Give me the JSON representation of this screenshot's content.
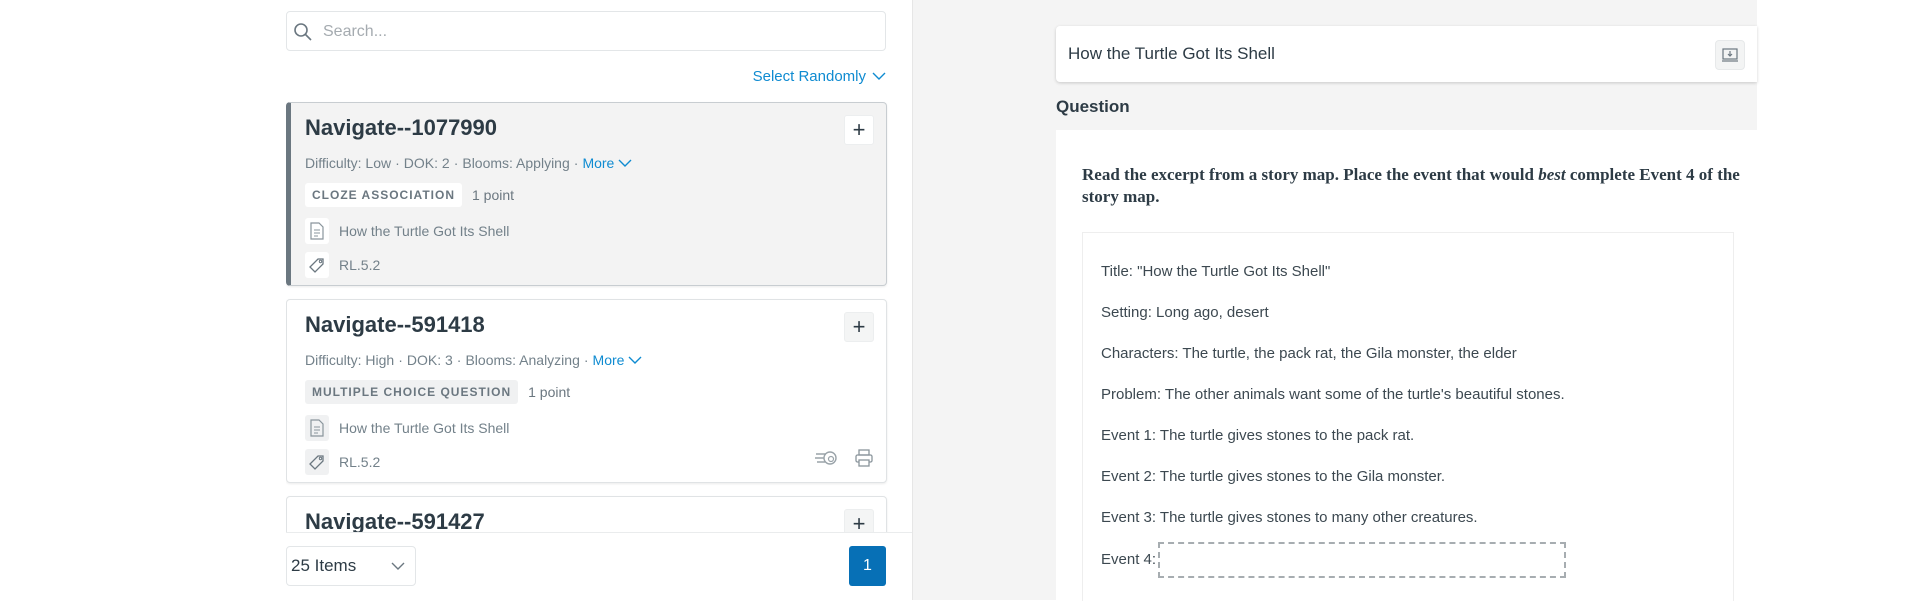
{
  "search": {
    "placeholder": "Search...",
    "value": ""
  },
  "select_randomly": "Select Randomly",
  "items": [
    {
      "title": "Navigate--1077990",
      "difficulty": "Difficulty: Low",
      "dok": "DOK: 2",
      "blooms": "Blooms: Applying",
      "more": "More",
      "type": "CLOZE ASSOCIATION",
      "points": "1 point",
      "passage": "How the Turtle Got Its Shell",
      "standard": "RL.5.2",
      "selected": true
    },
    {
      "title": "Navigate--591418",
      "difficulty": "Difficulty: High",
      "dok": "DOK: 3",
      "blooms": "Blooms: Analyzing",
      "more": "More",
      "type": "MULTIPLE CHOICE QUESTION",
      "points": "1 point",
      "passage": "How the Turtle Got Its Shell",
      "standard": "RL.5.2",
      "selected": false
    },
    {
      "title": "Navigate--591427"
    }
  ],
  "pagination": {
    "per_page": "25 Items",
    "current_page": "1"
  },
  "preview": {
    "passage_title": "How the Turtle Got Its Shell",
    "section_label": "Question",
    "stem_before": "Read the excerpt from a story map. Place the event that would ",
    "stem_emphasis": "best",
    "stem_after": " complete Event 4 of the story map.",
    "story_lines": [
      "Title: \"How the Turtle Got Its Shell\"",
      "Setting: Long ago, desert",
      "Characters: The turtle, the pack rat, the Gila monster, the elder",
      "Problem: The other animals want some of the turtle's beautiful stones.",
      "Event 1: The turtle gives stones to the pack rat.",
      "Event 2: The turtle gives stones to the Gila monster.",
      "Event 3: The turtle gives stones to many other creatures."
    ],
    "event4_label": "Event 4:"
  },
  "colors": {
    "accent": "#0f8bd1",
    "page_button": "#0770b6",
    "selected_border": "#6b7780"
  },
  "separator": "·"
}
